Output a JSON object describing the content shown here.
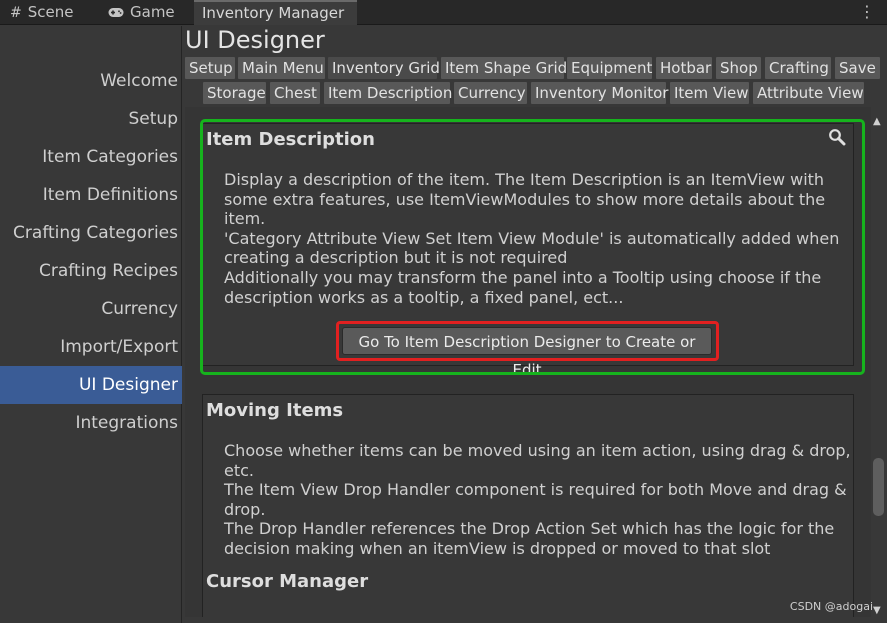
{
  "tabs": {
    "scene": "Scene",
    "game": "Game",
    "inventory": "Inventory Manager"
  },
  "sidebar": {
    "items": [
      {
        "label": "Welcome"
      },
      {
        "label": "Setup"
      },
      {
        "label": "Item Categories"
      },
      {
        "label": "Item Definitions"
      },
      {
        "label": "Crafting Categories"
      },
      {
        "label": "Crafting Recipes"
      },
      {
        "label": "Currency"
      },
      {
        "label": "Import/Export"
      },
      {
        "label": "UI Designer"
      },
      {
        "label": "Integrations"
      }
    ],
    "active": "UI Designer"
  },
  "main": {
    "title": "UI Designer",
    "toolbar_row1": [
      "Setup",
      "Main Menu",
      "Inventory Grid",
      "Item Shape Grid",
      "Equipment",
      "Hotbar",
      "Shop",
      "Crafting",
      "Save"
    ],
    "toolbar_row2": [
      "Storage",
      "Chest",
      "Item Description",
      "Currency",
      "Inventory Monitor",
      "Item View",
      "Attribute View"
    ],
    "selected_tool": "Inventory Grid"
  },
  "item_description": {
    "title": "Item Description",
    "lines": [
      "Display a description of the item. The Item Description is an ItemView with",
      "some extra features, use ItemViewModules to show more details about the",
      "item.",
      "'Category Attribute View Set Item View Module' is automatically added when",
      "creating a description but it is not required",
      "Additionally you may transform the panel into a Tooltip using choose if the",
      "description works as a tooltip, a fixed panel, ect..."
    ],
    "button": "Go To Item Description Designer to Create or Edit"
  },
  "moving_items": {
    "title": "Moving Items",
    "lines": [
      "Choose whether items can be moved using an item action, using drag & drop,",
      "etc.",
      "The Item View Drop Handler component is required for both Move and drag &",
      "drop.",
      "The Drop Handler references the Drop Action Set which has the logic for the",
      "decision making when an itemView is dropped or moved to that slot"
    ]
  },
  "cursor_manager": {
    "title": "Cursor Manager"
  },
  "watermark": "CSDN @adogai",
  "colors": {
    "highlight_green": "#16b31d",
    "highlight_red": "#e12020",
    "active_item": "#3a5c96"
  }
}
